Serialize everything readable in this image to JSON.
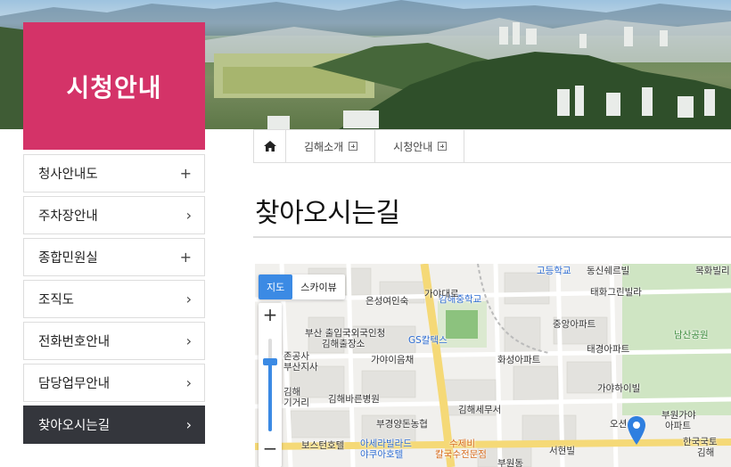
{
  "section": {
    "title": "시청안내"
  },
  "sidenav": {
    "items": [
      {
        "label": "청사안내도",
        "indicator": "+"
      },
      {
        "label": "주차장안내",
        "indicator": "›"
      },
      {
        "label": "종합민원실",
        "indicator": "+"
      },
      {
        "label": "조직도",
        "indicator": "›"
      },
      {
        "label": "전화번호안내",
        "indicator": "›"
      },
      {
        "label": "담당업무안내",
        "indicator": "›"
      },
      {
        "label": "찾아오시는길",
        "indicator": "›",
        "active": true
      }
    ]
  },
  "breadcrumb": {
    "items": [
      {
        "label": "김해소개"
      },
      {
        "label": "시청안내"
      }
    ]
  },
  "page": {
    "title": "찾아오시는길"
  },
  "map": {
    "type_buttons": [
      {
        "label": "지도",
        "active": true
      },
      {
        "label": "스카이뷰"
      }
    ],
    "zoom_in": "+",
    "zoom_out": "−",
    "zoom_level": 0.75,
    "labels": [
      {
        "text": "고등학교",
        "style": "blue"
      },
      {
        "text": "동신쉐르빌"
      },
      {
        "text": "목화빌리"
      },
      {
        "text": "태화그린빌라"
      },
      {
        "text": "은성여인숙"
      },
      {
        "text": "김해중학교",
        "style": "blue"
      },
      {
        "text": "중앙아파트"
      },
      {
        "text": "남산공원"
      },
      {
        "text": "부산 출입국외국인청"
      },
      {
        "text": "김해출장소"
      },
      {
        "text": "GS칼텍스",
        "style": "blue"
      },
      {
        "text": "태경아파트"
      },
      {
        "text": "존공사"
      },
      {
        "text": "부산지사"
      },
      {
        "text": "가야이음채"
      },
      {
        "text": "화성아파트"
      },
      {
        "text": "가야하이빌"
      },
      {
        "text": "김해"
      },
      {
        "text": "기거리"
      },
      {
        "text": "김해바른병원"
      },
      {
        "text": "김해세무서"
      },
      {
        "text": "부경양돈농협"
      },
      {
        "text": "오션"
      },
      {
        "text": "부원가야"
      },
      {
        "text": "아파트"
      },
      {
        "text": "보스턴호텔"
      },
      {
        "text": "아세라빌라드"
      },
      {
        "text": "야쿠아호텔"
      },
      {
        "text": "수제비"
      },
      {
        "text": "칼국수전문점"
      },
      {
        "text": "서현빌"
      },
      {
        "text": "한국국토"
      },
      {
        "text": "김해"
      },
      {
        "text": "부원동"
      },
      {
        "text": "가야대로"
      }
    ]
  },
  "colors": {
    "accent": "#d43368",
    "nav_active": "#34363c",
    "map_blue": "#3b8ae4"
  }
}
